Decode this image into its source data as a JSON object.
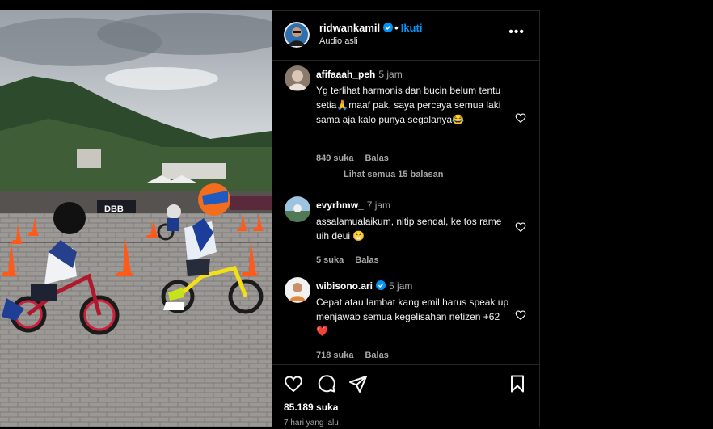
{
  "post": {
    "username": "ridwankamil",
    "follow_label": "Ikuti",
    "audio": "Audio asli",
    "banner_text": "DBB"
  },
  "comments": [
    {
      "user": "afifaaah_peh",
      "time": "5 jam",
      "text": "Yg terlihat harmonis dan bucin belum tentu setia🙏maaf pak, saya percaya semua laki sama aja kalo punya segalanya😂",
      "likes": "849 suka",
      "reply": "Balas",
      "view_replies": "Lihat semua 15 balasan"
    },
    {
      "user": "evyrhmw_",
      "time": "7 jam",
      "text": "assalamualaikum, nitip sendal, ke tos rame uih deui 😁",
      "likes": "5 suka",
      "reply": "Balas"
    },
    {
      "user": "wibisono.ari",
      "time": "5 jam",
      "text": "Cepat atau lambat kang emil harus speak up menjawab semua kegelisahan netizen +62 ❤️",
      "likes": "718 suka",
      "reply": "Balas"
    }
  ],
  "footer": {
    "like_count": "85.189 suka",
    "date": "7 hari yang lalu"
  },
  "colors": {
    "background": "#000000",
    "accent": "#0095f6",
    "secondary_text": "#a8a8a8"
  },
  "icons": [
    "heart-icon",
    "comment-icon",
    "share-icon",
    "bookmark-icon",
    "more-icon",
    "verified-badge-icon"
  ]
}
